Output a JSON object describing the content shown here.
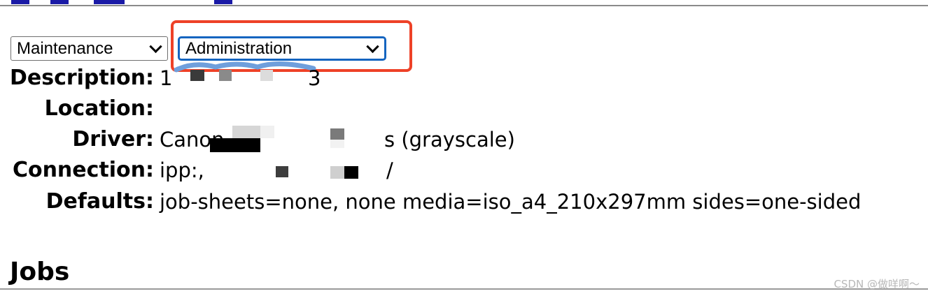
{
  "controls": {
    "maintenance_select": {
      "value": "Maintenance"
    },
    "administration_select": {
      "value": "Administration"
    }
  },
  "printer_info": {
    "description": {
      "label": "Description:",
      "value_start": "1",
      "value_end": "3"
    },
    "location": {
      "label": "Location:",
      "value": ""
    },
    "driver": {
      "label": "Driver:",
      "value_start": "Canon",
      "value_end": "s (grayscale)"
    },
    "connection": {
      "label": "Connection:",
      "value_start": "ipp:,",
      "value_end": "/"
    },
    "defaults": {
      "label": "Defaults:",
      "value": "job-sheets=none, none media=iso_a4_210x297mm sides=one-sided"
    }
  },
  "jobs_section": {
    "title": "Jobs"
  },
  "watermark": {
    "text": "CSDN @做咩啊～"
  },
  "colors": {
    "highlight_box": "#ee4127",
    "focus_ring": "#1565c0",
    "header_link_blue": "#1a1aa6"
  }
}
